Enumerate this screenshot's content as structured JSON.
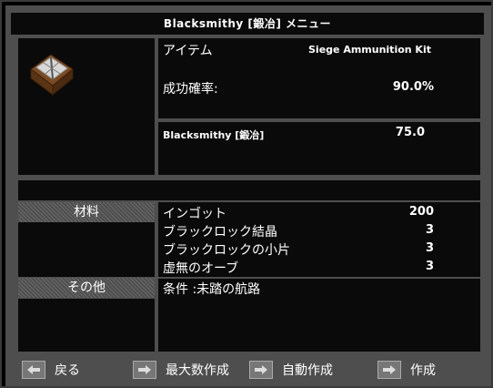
{
  "window": {
    "title": "Blacksmithy [鍛冶] メニュー"
  },
  "item": {
    "icon_name": "ammunition-kit-crate-icon",
    "name_label": "アイテム",
    "name_value": "Siege Ammunition Kit",
    "success_label": "成功確率:",
    "success_value": "90.0%",
    "skill_label": "Blacksmithy [鍛冶]",
    "skill_value": "75.0"
  },
  "materials": {
    "header": "材料",
    "rows": [
      {
        "name": "インゴット",
        "amount": "200"
      },
      {
        "name": "ブラックロック結晶",
        "amount": "3"
      },
      {
        "name": "ブラックロックの小片",
        "amount": "3"
      },
      {
        "name": "虚無のオーブ",
        "amount": "3"
      }
    ]
  },
  "other": {
    "header": "その他",
    "condition": "条件 :未踏の航路"
  },
  "footer": {
    "back": "戻る",
    "make_max": "最大数作成",
    "auto_make": "自動作成",
    "make": "作成"
  }
}
